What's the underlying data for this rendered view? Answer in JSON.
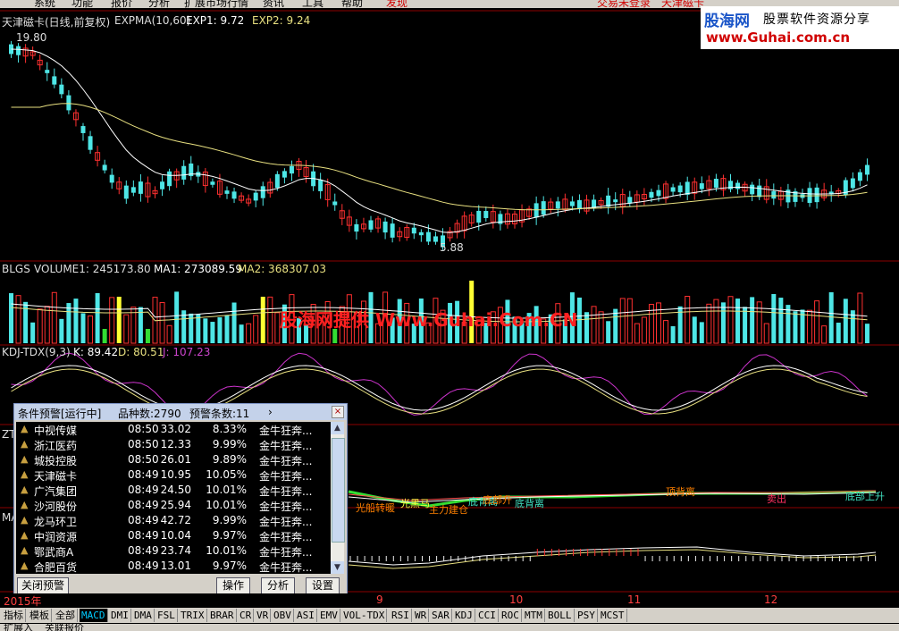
{
  "menubar": {
    "items": [
      "系统",
      "功能",
      "报价",
      "分析",
      "扩展市场行情",
      "资讯",
      "工具",
      "帮助"
    ],
    "red_item": "发现",
    "right_status": "交易未登录",
    "right_stock": "天津磁卡"
  },
  "logo": {
    "brand": "股海网",
    "slogan": "股票软件资源分享",
    "url": "www.Guhai.com.cn"
  },
  "main_panel": {
    "title": "天津磁卡(日线,前复权)",
    "indicator": "EXPMA(10,60)",
    "exp1": "EXP1: 9.72",
    "exp2": "EXP2: 9.24",
    "high_label": "19.80",
    "low_label": "5.88"
  },
  "volume_panel": {
    "name": "BLGS",
    "volume": "VOLUME1: 245173.80",
    "ma1": "MA1: 273089.59",
    "ma2": "MA2: 368307.03",
    "watermark": "股海网提供 Www.Guhai.Com.CN"
  },
  "kdj_panel": {
    "name": "KDJ-TDX(9,3)",
    "k": "K: 89.42",
    "d": "D: 80.51",
    "j": "J: 107.23"
  },
  "panel4": {
    "prefix": "ZT",
    "signals": [
      "光船转暖",
      "光黑马",
      "主力建仓",
      "底背离",
      "底部升",
      "顶背离",
      "卖出",
      "底部上升"
    ]
  },
  "panel5": {
    "prefix": "MA"
  },
  "alert_window": {
    "title": "条件预警[运行中]",
    "count": "品种数:2790",
    "alerts": "预警条数:11",
    "nav": "›",
    "close": "×",
    "rows": [
      {
        "name": "中视传媒",
        "time": "08:50",
        "price": "33.02",
        "pct": "8.33%",
        "signal": "金牛狂奔..."
      },
      {
        "name": "浙江医药",
        "time": "08:50",
        "price": "12.33",
        "pct": "9.99%",
        "signal": "金牛狂奔..."
      },
      {
        "name": "城投控股",
        "time": "08:50",
        "price": "26.01",
        "pct": "9.89%",
        "signal": "金牛狂奔..."
      },
      {
        "name": "天津磁卡",
        "time": "08:49",
        "price": "10.95",
        "pct": "10.05%",
        "signal": "金牛狂奔..."
      },
      {
        "name": "广汽集团",
        "time": "08:49",
        "price": "24.50",
        "pct": "10.01%",
        "signal": "金牛狂奔..."
      },
      {
        "name": "沙河股份",
        "time": "08:49",
        "price": "25.94",
        "pct": "10.01%",
        "signal": "金牛狂奔..."
      },
      {
        "name": "龙马环卫",
        "time": "08:49",
        "price": "42.72",
        "pct": "9.99%",
        "signal": "金牛狂奔..."
      },
      {
        "name": "中润资源",
        "time": "08:49",
        "price": "10.04",
        "pct": "9.97%",
        "signal": "金牛狂奔..."
      },
      {
        "name": "鄂武商A",
        "time": "08:49",
        "price": "23.74",
        "pct": "10.01%",
        "signal": "金牛狂奔..."
      },
      {
        "name": "合肥百货",
        "time": "08:49",
        "price": "13.01",
        "pct": "9.97%",
        "signal": "金牛狂奔..."
      }
    ],
    "buttons": {
      "close_alert": "关闭预警",
      "operate": "操作",
      "analyze": "分析",
      "settings": "设置"
    }
  },
  "date_axis": {
    "year": "2015年",
    "months": [
      "9",
      "10",
      "11",
      "12"
    ]
  },
  "tabs": [
    "指标",
    "模板",
    "全部",
    "MACD",
    "DMI",
    "DMA",
    "FSL",
    "TRIX",
    "BRAR",
    "CR",
    "VR",
    "OBV",
    "ASI",
    "EMV",
    "VOL-TDX",
    "RSI",
    "WR",
    "SAR",
    "KDJ",
    "CCI",
    "ROC",
    "MTM",
    "BOLL",
    "PSY",
    "MCST"
  ],
  "active_tab": "MACD",
  "statusbar": {
    "left": "扩展入",
    "right": "关联报价"
  },
  "colors": {
    "up": "#ff3030",
    "down": "#4ee6e6",
    "exp1": "#ffffff",
    "exp2": "#e8e080",
    "kdj_j": "#cc33cc",
    "highlight_vol": "#ffff33",
    "green_vol": "#33dd33"
  }
}
